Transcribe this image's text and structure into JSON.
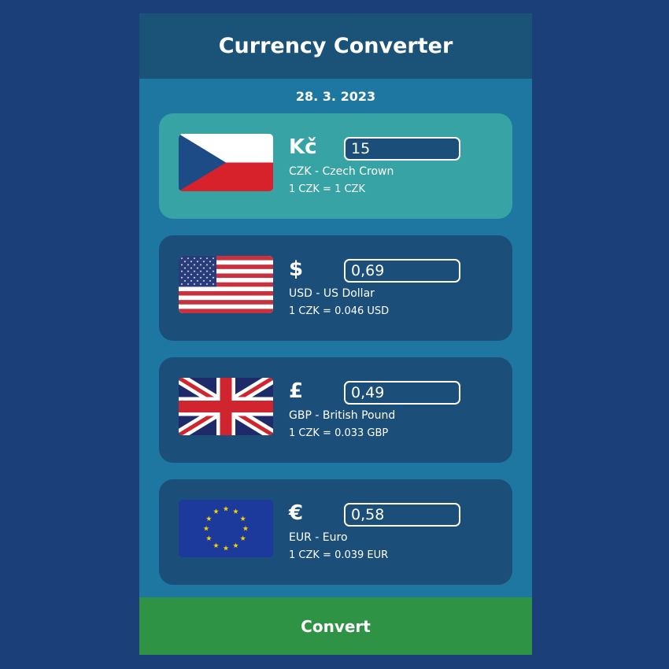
{
  "header": {
    "title": "Currency Converter"
  },
  "date": "28. 3. 2023",
  "currencies": [
    {
      "code_name": "CZK - Czech Crown",
      "symbol": "Kč",
      "amount": "15",
      "rate": "1 CZK = 1 CZK",
      "flag": "czech-flag-icon",
      "active": true
    },
    {
      "code_name": "USD - US Dollar",
      "symbol": "$",
      "amount": "0,69",
      "rate": "1 CZK = 0.046 USD",
      "flag": "us-flag-icon",
      "active": false
    },
    {
      "code_name": "GBP - British Pound",
      "symbol": "£",
      "amount": "0,49",
      "rate": "1 CZK = 0.033 GBP",
      "flag": "uk-flag-icon",
      "active": false
    },
    {
      "code_name": "EUR - Euro",
      "symbol": "€",
      "amount": "0,58",
      "rate": "1 CZK = 0.039 EUR",
      "flag": "eu-flag-icon",
      "active": false
    }
  ],
  "convert_label": "Convert",
  "colors": {
    "background": "#1b3f78",
    "panel": "#1e77a0",
    "header": "#1b5378",
    "card": "#1b4e78",
    "card_active": "#38a3a5",
    "convert": "#2e9344"
  }
}
